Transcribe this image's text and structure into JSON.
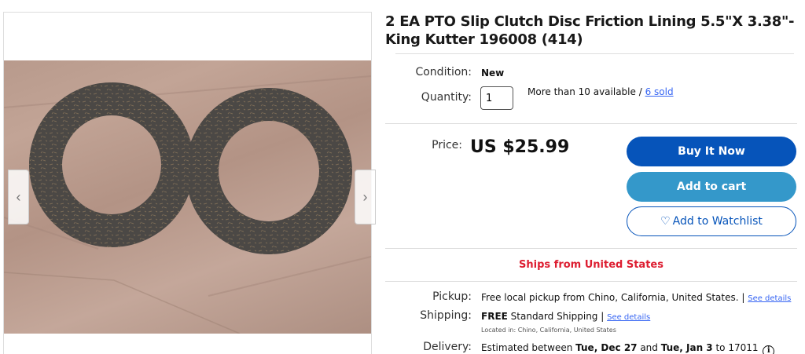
{
  "gallery": {
    "prev_icon": "chevron-left-icon",
    "next_icon": "chevron-right-icon",
    "prev_glyph": "‹",
    "next_glyph": "›"
  },
  "listing": {
    "title": "2 EA PTO Slip Clutch Disc Friction Lining 5.5\"X 3.38\"-King Kutter 196008 (414)",
    "condition_label": "Condition:",
    "condition_value": "New",
    "quantity_label": "Quantity:",
    "quantity_value": "1",
    "availability": "More than 10 available / ",
    "sold_link": "6 sold",
    "price_label": "Price:",
    "price_value": "US $25.99"
  },
  "buttons": {
    "buy_now": "Buy It Now",
    "add_to_cart": "Add to cart",
    "watchlist": "Add to Watchlist",
    "watchlist_icon": "heart-icon",
    "watchlist_glyph": "♡"
  },
  "ships_from": "Ships from United States",
  "shipping": {
    "pickup_label": "Pickup:",
    "pickup_text": "Free local pickup from Chino, California, United States. | ",
    "pickup_link": "See details",
    "shipping_label": "Shipping:",
    "shipping_free": "FREE",
    "shipping_text": " Standard Shipping | ",
    "shipping_link": "See details",
    "located": "Located in: Chino, California, United States",
    "delivery_label": "Delivery:",
    "delivery_pre": "Estimated between ",
    "delivery_start": "Tue, Dec 27",
    "delivery_and": " and ",
    "delivery_end": "Tue, Jan 3",
    "delivery_post": " to 17011 ",
    "info_icon": "info-icon",
    "info_glyph": "i"
  },
  "colors": {
    "primary": "#0654ba",
    "cart": "#3498ca",
    "ships": "#dd1e31",
    "link": "#3665f3"
  }
}
